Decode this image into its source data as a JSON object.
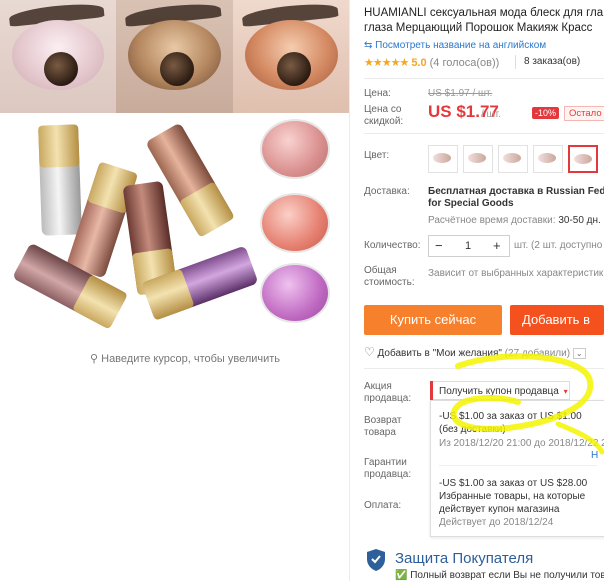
{
  "product": {
    "title_line1": "HUAMIANLI сексуальная мода блеск для гла",
    "title_line2": "глаза Мерцающий Порошок Макияж Красс",
    "translate_link": "Посмотреть название на английском",
    "rating_stars": "★★★★★",
    "rating_value": "5.0",
    "rating_votes": "(4 голоса(ов))",
    "orders": "8 заказа(ов)"
  },
  "gallery": {
    "zoom_hint": "Наведите курсор, чтобы увеличить"
  },
  "price": {
    "label": "Цена:",
    "old": "US $1.97 / шт.",
    "discount_label_1": "Цена со",
    "discount_label_2": "скидкой:",
    "new": "US $1.77",
    "unit": "/ шт.",
    "discount": "-10%",
    "stock_badge": "Остало"
  },
  "color": {
    "label": "Цвет:"
  },
  "shipping": {
    "label": "Доставка:",
    "text_line1": "Бесплатная доставка в Russian Fede",
    "text_line2": "for Special Goods",
    "time_label": "Расчётное время доставки:",
    "time_value": "30-50 дн."
  },
  "quantity": {
    "label": "Количество:",
    "minus": "−",
    "value": "1",
    "plus": "+",
    "note": "шт. (2 шт. доступно"
  },
  "total": {
    "label_1": "Общая",
    "label_2": "стоимость:",
    "value": "Зависит от выбранных характеристик"
  },
  "buttons": {
    "buy_now": "Купить сейчас",
    "add_to_cart": "Добавить в"
  },
  "wishlist": {
    "text": "Добавить в \"Мои желания\"",
    "count": "(27 добавили)"
  },
  "seller_promo": {
    "label_1": "Акция",
    "label_2": "продавца:",
    "coupon_button": "Получить купон продавца",
    "coupon_arrow": "▾"
  },
  "returns": {
    "label_1": "Возврат",
    "label_2": "товара"
  },
  "warranty": {
    "label_1": "Гарантии",
    "label_2": "продавца:"
  },
  "payment": {
    "label": "Оплата:"
  },
  "coupons": [
    {
      "line1": "-US $1.00 за заказ от US $1.00",
      "line2": "(без доставки)",
      "dates": "Из 2018/12/20 21:00 до 2018/12/22 2",
      "extra": "Н"
    },
    {
      "line1": "-US $1.00 за заказ от US $28.00",
      "line2": "Избранные товары, на которые",
      "line3": "действует купон магазина",
      "dates": "Действует до 2018/12/24"
    }
  ],
  "protection": {
    "title": "Защита Покупателя",
    "line": "Полный возврат если Вы не получили товар"
  },
  "colors": {
    "accent_red": "#e4393c",
    "buy_orange": "#f7802d",
    "cart_orange": "#f4511e",
    "link_blue": "#2878cc",
    "highlighter_yellow": "#f5f500"
  }
}
